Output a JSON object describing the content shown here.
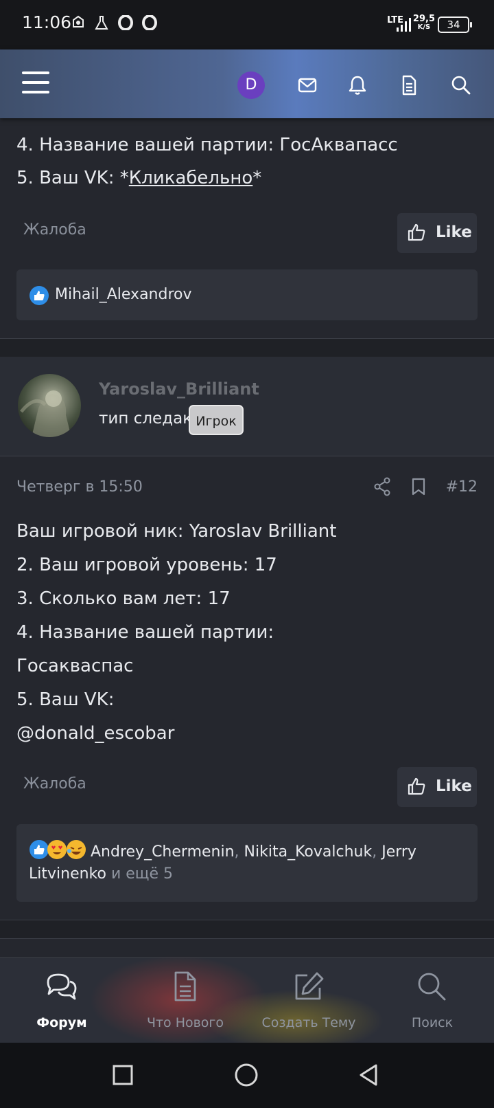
{
  "status_bar": {
    "time": "11:06",
    "lte": "LTE",
    "net_speed_value": "29,5",
    "net_speed_unit": "K/S",
    "battery": "34"
  },
  "header": {
    "avatar_letter": "D"
  },
  "post_prev": {
    "lines": [
      "4. Название вашей партии: ГосАквапасс",
      "5. Ваш VK: *"
    ],
    "vk_link": "Кликабельно",
    "vk_suffix": "*",
    "report": "Жалоба",
    "like": "Like",
    "reactions_user": "Mihail_Alexandrov"
  },
  "post": {
    "username": "Yaroslav_Brilliant",
    "user_title": "тип следак",
    "badge": "Игрок",
    "date": "Четверг в 15:50",
    "number": "#12",
    "lines": [
      "Ваш игровой ник: Yaroslav Brilliant",
      "2. Ваш игровой уровень: 17",
      "3. Сколько вам лет: 17",
      "4. Название вашей партии:",
      "Госакваспас",
      "5. Ваш VK:",
      "@donald_escobar"
    ],
    "report": "Жалоба",
    "like": "Like",
    "reactions": {
      "user1": "Andrey_Chermenin",
      "sep": ", ",
      "user2": "Nikita_Kovalchuk",
      "user3": "Jerry",
      "user3b": "Litvinenko",
      "more": " и ещё 5"
    }
  },
  "bottom_nav": [
    {
      "label": "Форум",
      "icon": "forum-icon",
      "active": true
    },
    {
      "label": "Что Нового",
      "icon": "document-icon",
      "active": false
    },
    {
      "label": "Создать Тему",
      "icon": "edit-icon",
      "active": false
    },
    {
      "label": "Поиск",
      "icon": "search-icon",
      "active": false
    }
  ]
}
